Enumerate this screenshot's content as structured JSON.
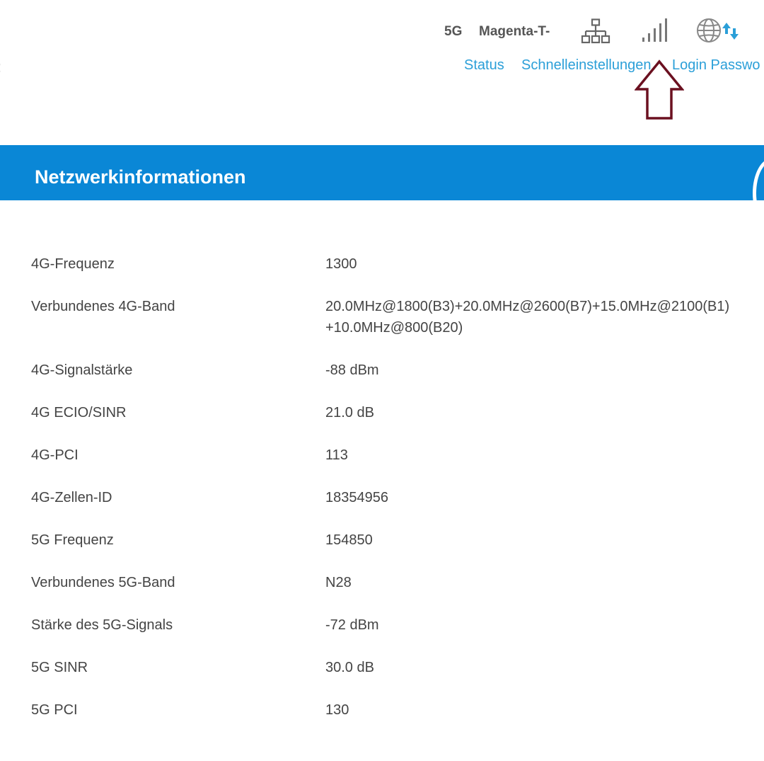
{
  "status_bar": {
    "network_type": "5G",
    "operator": "Magenta-T-",
    "icons": [
      "lan-icon",
      "signal-strength-icon",
      "globe-icon",
      "data-transfer-icon"
    ],
    "signal_bars_active": 5
  },
  "nav": {
    "status": "Status",
    "quick_settings": "Schnelleinstellungen",
    "login_password": "Login Passwo"
  },
  "annotation": {
    "arrow_color": "#6b1020"
  },
  "section": {
    "title": "Netzwerkinformationen"
  },
  "colors": {
    "header_blue": "#0a87d6",
    "link_blue": "#2b9fd8",
    "text_gray": "#444444"
  },
  "info_rows": [
    {
      "label": "4G-Frequenz",
      "value": "1300"
    },
    {
      "label": "Verbundenes 4G-Band",
      "value": "20.0MHz@1800(B3)+20.0MHz@2600(B7)+15.0MHz@2100(B1)",
      "value2": "+10.0MHz@800(B20)"
    },
    {
      "label": "4G-Signalstärke",
      "value": "-88 dBm"
    },
    {
      "label": "4G ECIO/SINR",
      "value": "21.0 dB"
    },
    {
      "label": "4G-PCI",
      "value": "113"
    },
    {
      "label": "4G-Zellen-ID",
      "value": "18354956"
    },
    {
      "label": "5G Frequenz",
      "value": "154850"
    },
    {
      "label": "Verbundenes 5G-Band",
      "value": "N28"
    },
    {
      "label": "Stärke des 5G-Signals",
      "value": "-72 dBm"
    },
    {
      "label": "5G SINR",
      "value": "30.0 dB"
    },
    {
      "label": "5G PCI",
      "value": "130"
    }
  ]
}
